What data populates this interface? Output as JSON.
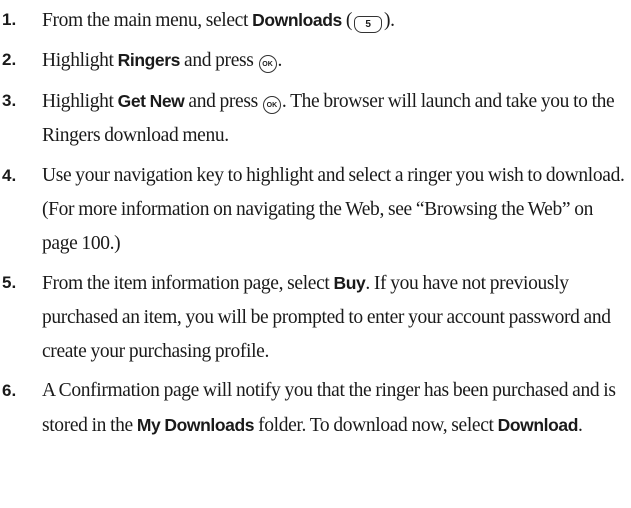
{
  "steps": [
    {
      "num": "1.",
      "t1": "From the main menu, select ",
      "b1": "Downloads",
      "t2": " (",
      "key": "5",
      "t3": ")."
    },
    {
      "num": "2.",
      "t1": "Highlight ",
      "b1": "Ringers",
      "t2": " and press ",
      "key": "OK",
      "t3": "."
    },
    {
      "num": "3.",
      "t1": "Highlight ",
      "b1": "Get New",
      "t2": " and press ",
      "key": "OK",
      "t3": ". The browser will launch and take you to the Ringers download menu."
    },
    {
      "num": "4.",
      "t1": "Use your navigation key to highlight and select a ringer you wish to download. (For more information on navigating the Web, see “Browsing the Web” on page 100.)"
    },
    {
      "num": "5.",
      "t1": "From the item information page, select ",
      "b1": "Buy",
      "t2": ". If you have not previously purchased an item, you will be prompted to enter your account password and create your purchasing profile."
    },
    {
      "num": "6.",
      "t1": "A Confirmation page will notify you that the ringer has been purchased and is stored in the ",
      "b1": "My Downloads",
      "t2": " folder. To download now, select ",
      "b2": "Download",
      "t3": "."
    }
  ]
}
